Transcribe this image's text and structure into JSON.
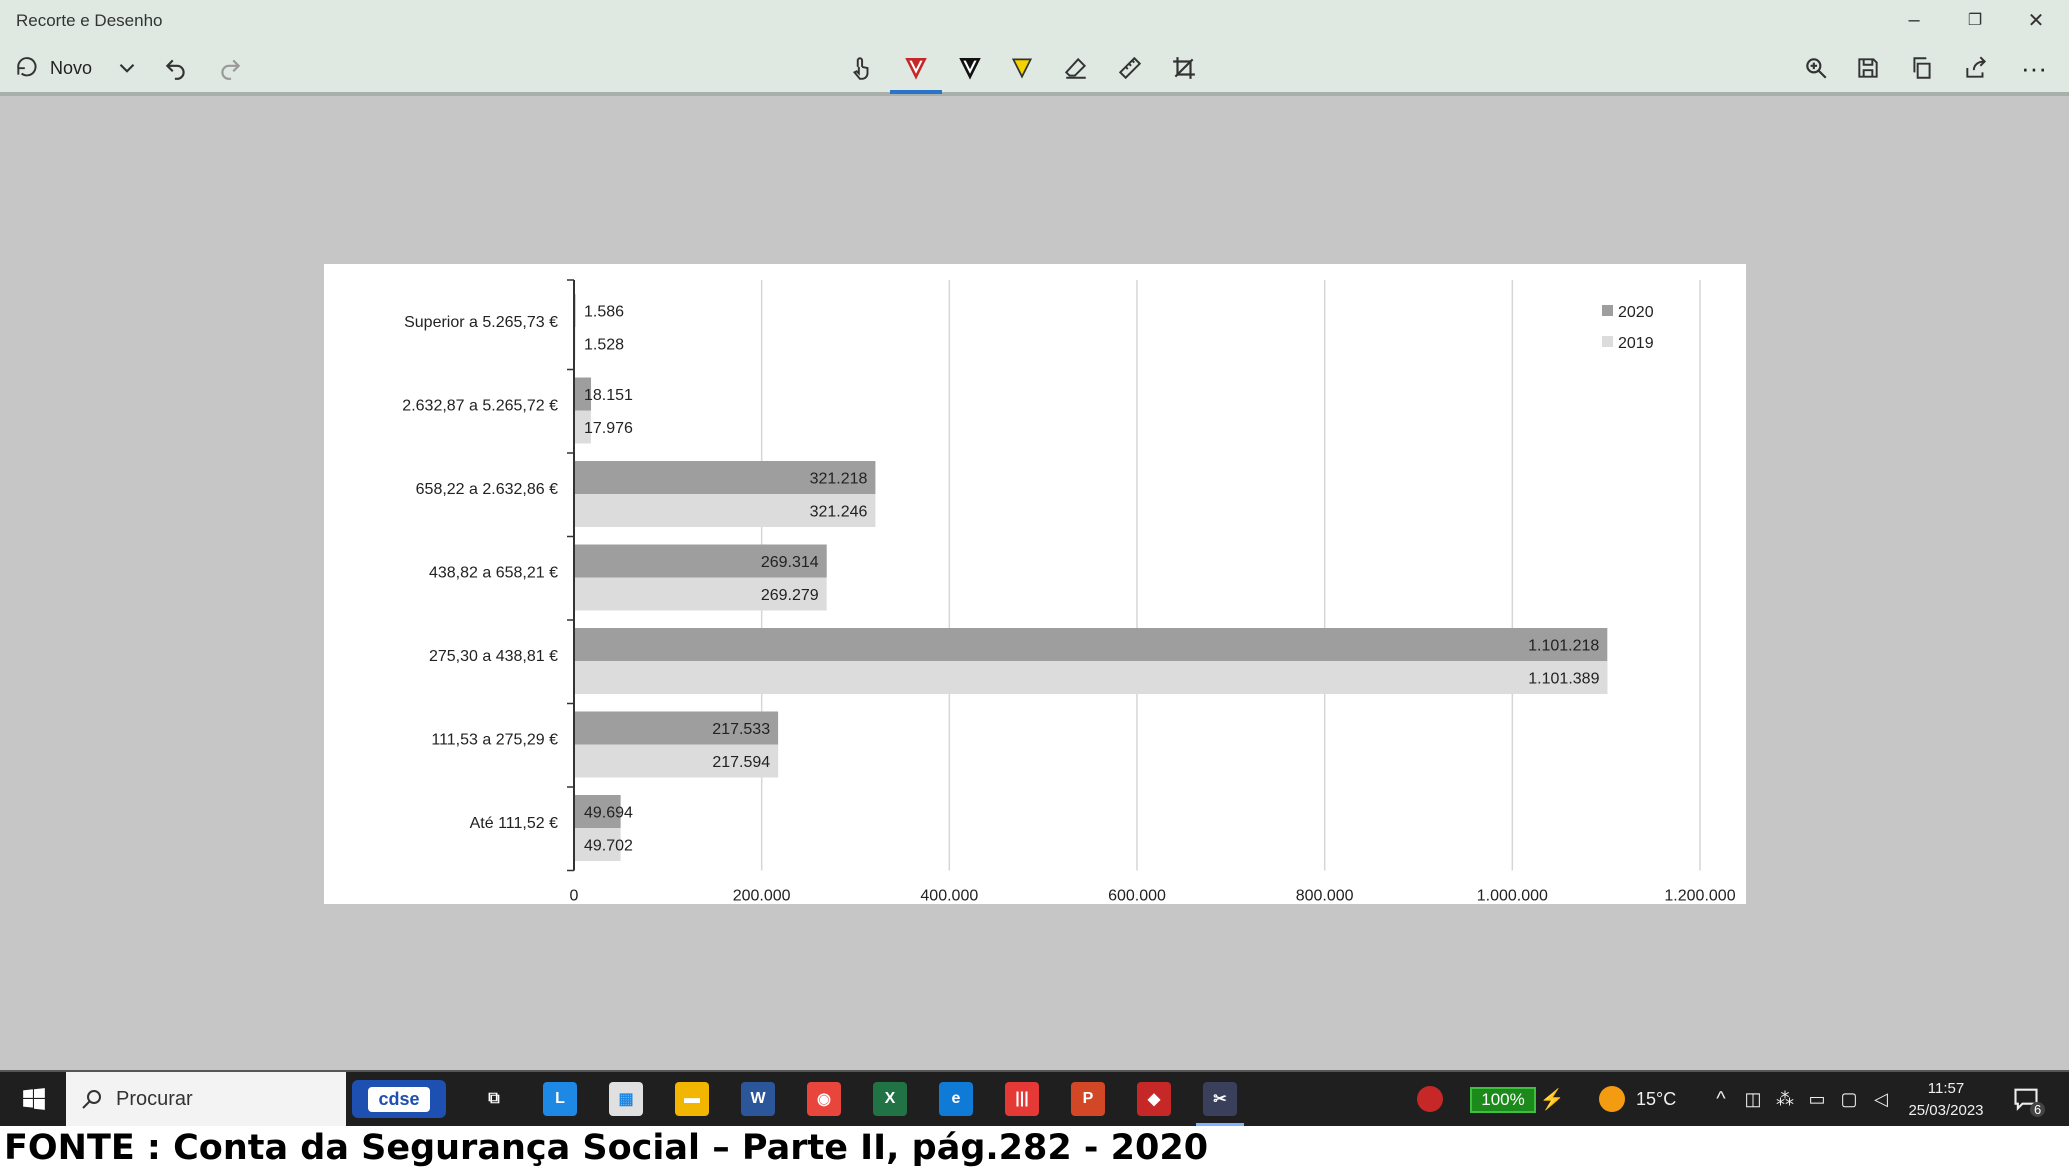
{
  "window": {
    "title": "Recorte e Desenho",
    "controls": {
      "minimize": "–",
      "maximize": "❐",
      "close": "✕"
    }
  },
  "toolbar": {
    "new_label": "Novo",
    "tools": [
      "touch-writing",
      "ballpoint-pen",
      "pencil",
      "highlighter",
      "eraser",
      "ruler",
      "crop"
    ],
    "right_tools": [
      "zoom",
      "save",
      "copy",
      "share",
      "more"
    ],
    "more_label": "···"
  },
  "chart_data": {
    "type": "bar",
    "orientation": "horizontal",
    "categories": [
      "Superior a 5.265,73 €",
      "2.632,87 a 5.265,72 €",
      "658,22 a 2.632,86 €",
      "438,82 a 658,21 €",
      "275,30 a 438,81 €",
      "111,53 a 275,29 €",
      "Até 111,52 €"
    ],
    "series": [
      {
        "name": "2020",
        "color": "#9e9e9e",
        "values": [
          1586,
          18151,
          321218,
          269314,
          1101218,
          217533,
          49694
        ],
        "labels": [
          "1.586",
          "18.151",
          "321.218",
          "269.314",
          "1.101.218",
          "217.533",
          "49.694"
        ]
      },
      {
        "name": "2019",
        "color": "#dcdcdc",
        "values": [
          1528,
          17976,
          321246,
          269279,
          1101389,
          217594,
          49702
        ],
        "labels": [
          "1.528",
          "17.976",
          "321.246",
          "269.279",
          "1.101.389",
          "217.594",
          "49.702"
        ]
      }
    ],
    "xlim": [
      0,
      1200000
    ],
    "xticks": [
      0,
      200000,
      400000,
      600000,
      800000,
      1000000,
      1200000
    ],
    "xtick_labels": [
      "0",
      "200.000",
      "400.000",
      "600.000",
      "800.000",
      "1.000.000",
      "1.200.000"
    ],
    "grid": "vertical",
    "legend_position": "top-right"
  },
  "taskbar": {
    "search_placeholder": "Procurar",
    "cdse_label": "cdse",
    "battery": "100%",
    "temperature": "15°C",
    "time": "11:57",
    "date": "25/03/2023",
    "notifications": "6",
    "apps": [
      {
        "name": "task-view",
        "label": "⧉",
        "color": "#1f1f1f"
      },
      {
        "name": "l-app",
        "label": "L",
        "color": "#1e88e5"
      },
      {
        "name": "store",
        "label": "▦",
        "color": "#e0e0e0"
      },
      {
        "name": "file-explorer",
        "label": "▬",
        "color": "#f2b600"
      },
      {
        "name": "word",
        "label": "W",
        "color": "#2b579a"
      },
      {
        "name": "chrome",
        "label": "◉",
        "color": "#e8453c"
      },
      {
        "name": "excel",
        "label": "X",
        "color": "#217346"
      },
      {
        "name": "edge",
        "label": "e",
        "color": "#0f7bd7"
      },
      {
        "name": "red-app",
        "label": "|||",
        "color": "#e53935"
      },
      {
        "name": "powerpoint",
        "label": "P",
        "color": "#d24726"
      },
      {
        "name": "red-cube-app",
        "label": "◆",
        "color": "#c62828"
      },
      {
        "name": "snip-sketch",
        "label": "✂",
        "color": "#3a3f5c"
      }
    ]
  },
  "caption": "FONTE : Conta da Segurança Social – Parte II, pág.282 - 2020"
}
